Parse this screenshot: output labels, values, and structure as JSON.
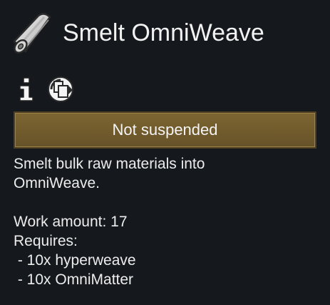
{
  "header": {
    "title": "Smelt OmniWeave",
    "item_icon": "fabric-bolt-icon"
  },
  "icons": {
    "info": "info-icon",
    "copy": "copy-settings-icon"
  },
  "suspend_button": {
    "label": "Not suspended"
  },
  "description": {
    "lines": [
      "Smelt bulk raw materials into",
      "OmniWeave.",
      "",
      "Work amount: 17",
      "Requires:",
      " - 10x hyperweave",
      " - 10x OmniMatter"
    ]
  },
  "colors": {
    "background": "#15191d",
    "button_fill": "#715b2c",
    "button_border": "#4e3f22",
    "text": "#ececec"
  }
}
